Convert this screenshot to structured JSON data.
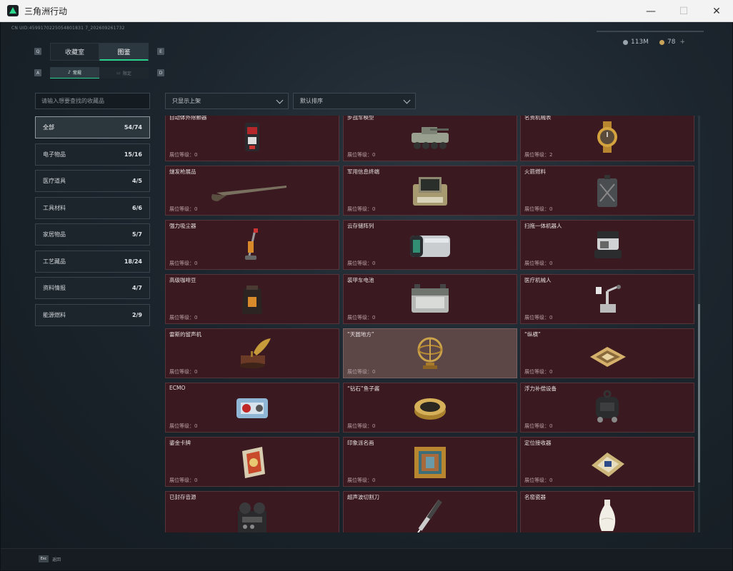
{
  "window": {
    "title": "三角洲行动",
    "minimize": "—",
    "maximize": "☐",
    "close": "✕"
  },
  "header": {
    "uid": "CN UID:4599170225054801831 7_202609261732",
    "currency": [
      {
        "value": "113M",
        "color": "#9aa4ab"
      },
      {
        "value": "78",
        "color": "#c9a35a"
      }
    ],
    "plus": "+"
  },
  "tabs": [
    {
      "label": "收藏室",
      "active": false
    },
    {
      "label": "图鉴",
      "active": true
    }
  ],
  "tab_keys": [
    "Q",
    "E"
  ],
  "subtabs": [
    {
      "label": "常规",
      "icon": "music-note-icon",
      "active": true
    },
    {
      "label": "限定",
      "icon": "box-icon",
      "active": false
    }
  ],
  "subtab_keys": [
    "A",
    "D"
  ],
  "search": {
    "placeholder": "请输入想要查找的收藏品"
  },
  "filters": {
    "shelf": "只显示上架",
    "sort": "默认排序"
  },
  "categories": [
    {
      "label": "全部",
      "count": "54/74",
      "active": true
    },
    {
      "label": "电子物品",
      "count": "15/16"
    },
    {
      "label": "医疗道具",
      "count": "4/5"
    },
    {
      "label": "工具材料",
      "count": "6/6"
    },
    {
      "label": "家居物品",
      "count": "5/7"
    },
    {
      "label": "工艺藏品",
      "count": "18/24"
    },
    {
      "label": "资料情报",
      "count": "4/7"
    },
    {
      "label": "能源燃料",
      "count": "2/9"
    }
  ],
  "level_prefix": "展位等级：",
  "items": [
    {
      "name": "自动体外除颤器",
      "level": "0",
      "icon": "defibrillator-icon"
    },
    {
      "name": "步战车模型",
      "level": "0",
      "icon": "armored-vehicle-icon"
    },
    {
      "name": "名贵机械表",
      "level": "2",
      "icon": "watch-icon"
    },
    {
      "name": "燧发枪展品",
      "level": "0",
      "icon": "musket-icon"
    },
    {
      "name": "军用信息终端",
      "level": "0",
      "icon": "terminal-icon"
    },
    {
      "name": "火箭燃料",
      "level": "0",
      "icon": "fuel-can-icon"
    },
    {
      "name": "强力吸尘器",
      "level": "0",
      "icon": "vacuum-icon"
    },
    {
      "name": "云存储阵列",
      "level": "0",
      "icon": "storage-array-icon"
    },
    {
      "name": "扫拖一体机器人",
      "level": "0",
      "icon": "robot-vacuum-icon"
    },
    {
      "name": "高级咖啡豆",
      "level": "0",
      "icon": "coffee-bag-icon"
    },
    {
      "name": "装甲车电池",
      "level": "0",
      "icon": "battery-icon"
    },
    {
      "name": "医疗机械人",
      "level": "0",
      "icon": "medical-robot-icon"
    },
    {
      "name": "雷斯的留声机",
      "level": "0",
      "icon": "gramophone-icon"
    },
    {
      "name": "“天圆地方”",
      "level": "0",
      "icon": "armillary-icon",
      "alt": true
    },
    {
      "name": "“纵横”",
      "level": "0",
      "icon": "chessboard-icon"
    },
    {
      "name": "ECMO",
      "level": "0",
      "icon": "ecmo-icon"
    },
    {
      "name": "“钻石”鱼子酱",
      "level": "0",
      "icon": "caviar-tin-icon"
    },
    {
      "name": "浮力补偿设备",
      "level": "0",
      "icon": "bcd-icon"
    },
    {
      "name": "鎏金卡牌",
      "level": "0",
      "icon": "gold-card-icon"
    },
    {
      "name": "印象派名画",
      "level": "0",
      "icon": "painting-icon"
    },
    {
      "name": "定位接收器",
      "level": "0",
      "icon": "receiver-icon"
    },
    {
      "name": "已封存音源",
      "level": "",
      "icon": "tape-recorder-icon"
    },
    {
      "name": "超声波切割刀",
      "level": "",
      "icon": "cutter-icon"
    },
    {
      "name": "名窑瓷器",
      "level": "",
      "icon": "vase-icon"
    }
  ],
  "footer": {
    "esc": "Esc",
    "back": "返回"
  }
}
